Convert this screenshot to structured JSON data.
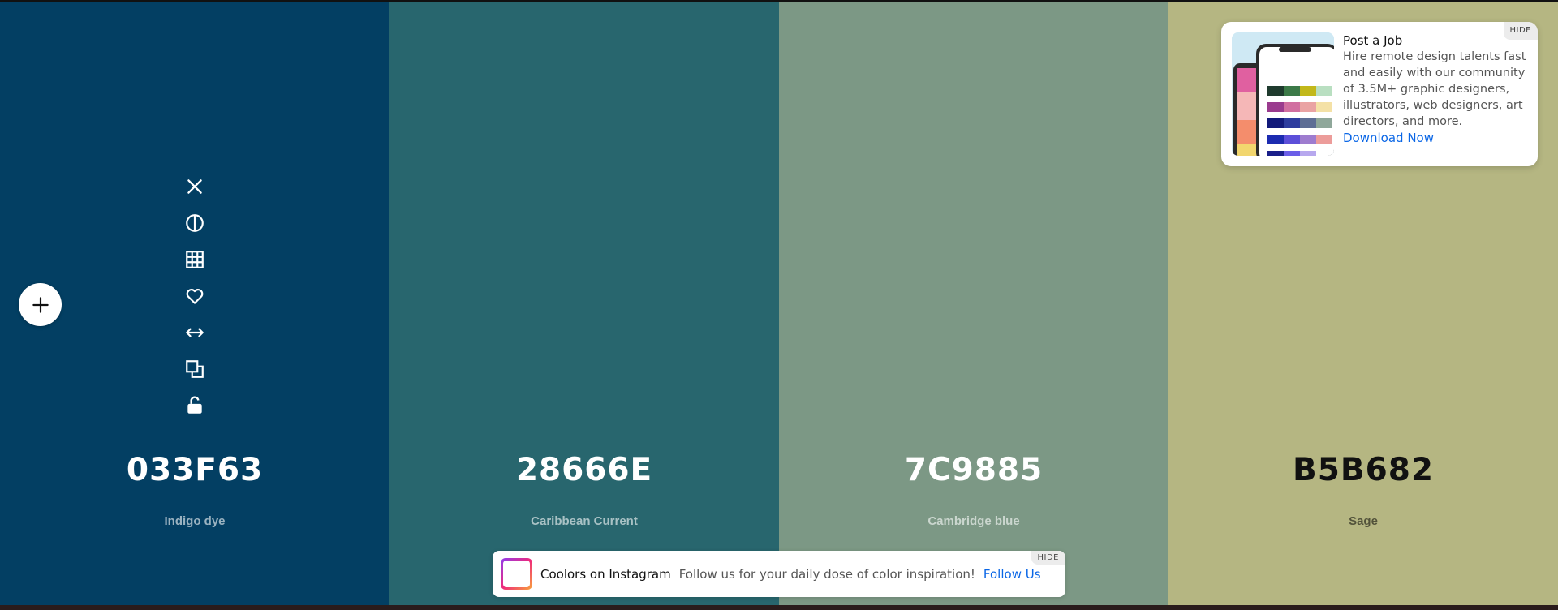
{
  "palette": [
    {
      "hex": "033F63",
      "name": "Indigo dye",
      "color": "#033F63",
      "text": "light"
    },
    {
      "hex": "28666E",
      "name": "Caribbean Current",
      "color": "#28666E",
      "text": "light"
    },
    {
      "hex": "7C9885",
      "name": "Cambridge blue",
      "color": "#7C9885",
      "text": "light"
    },
    {
      "hex": "B5B682",
      "name": "Sage",
      "color": "#B5B682",
      "text": "dark"
    }
  ],
  "tools": [
    "close-icon",
    "contrast-icon",
    "grid-icon",
    "heart-icon",
    "drag-arrows-icon",
    "copy-icon",
    "unlock-icon"
  ],
  "ad": {
    "title": "Post a Job",
    "description": "Hire remote design talents fast and easily with our community of 3.5M+ graphic designers, illustrators, web designers, art directors, and more.",
    "cta": "Download Now",
    "hide": "HIDE"
  },
  "instagram": {
    "title": "Coolors on Instagram",
    "description": "Follow us for your daily dose of color inspiration!",
    "cta": "Follow Us",
    "hide": "HIDE"
  }
}
